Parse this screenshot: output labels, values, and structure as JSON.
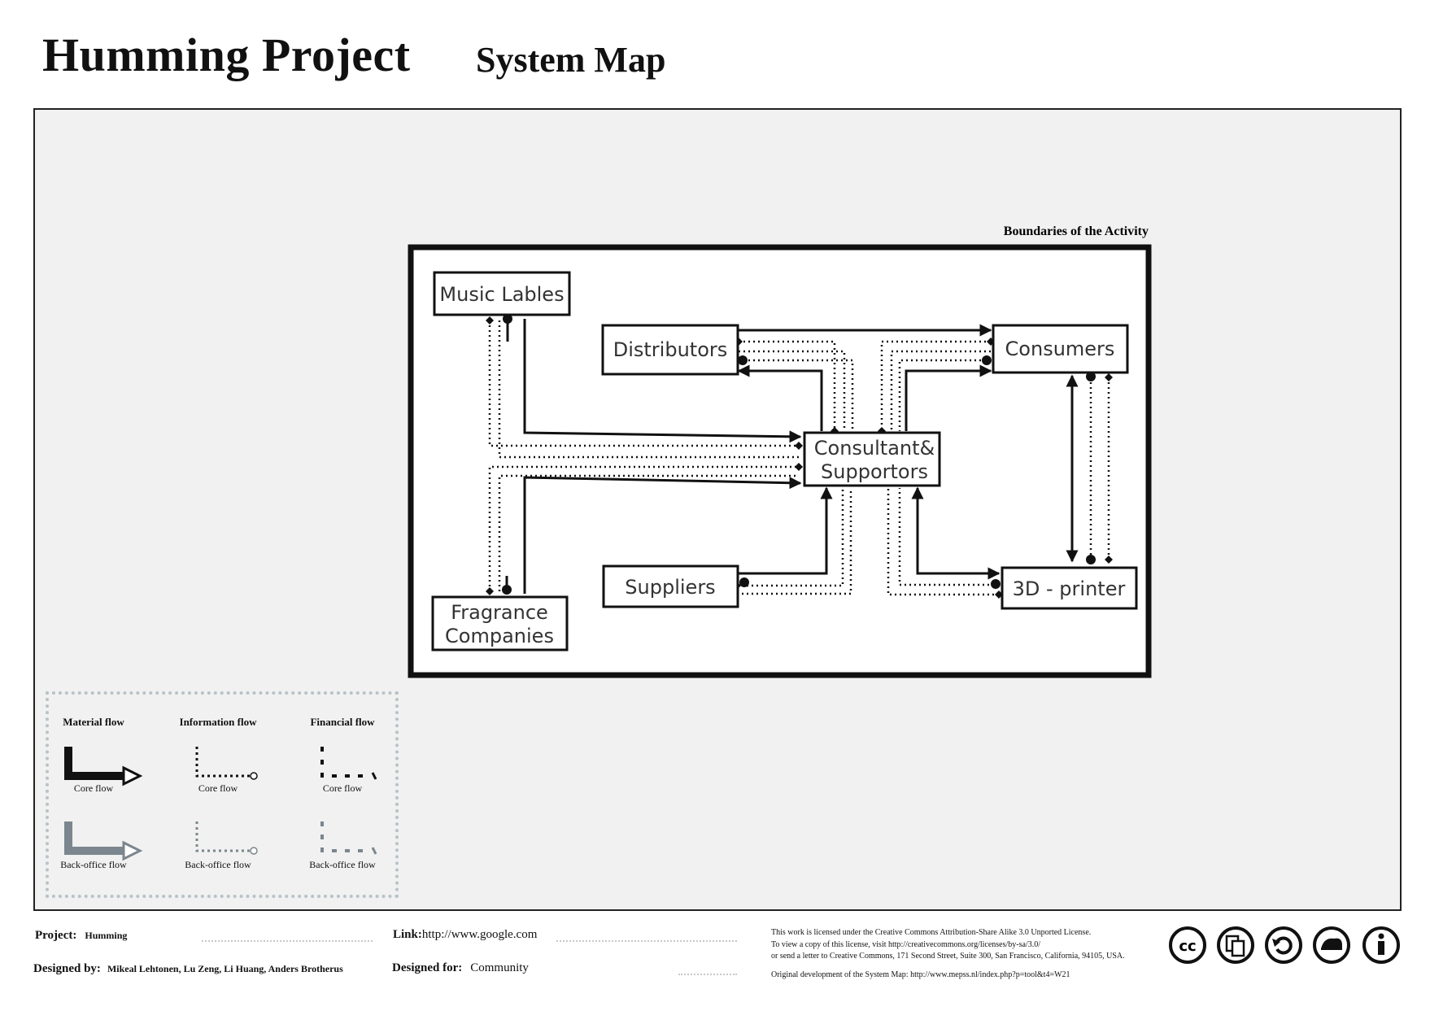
{
  "header": {
    "title": "Humming Project",
    "subtitle": "System Map"
  },
  "boundary_label": "Boundaries of the Activity",
  "nodes": {
    "music": "Music Lables",
    "distributors": "Distributors",
    "consumers": "Consumers",
    "consultant_line1": "Consultant&",
    "consultant_line2": "Supportors",
    "suppliers": "Suppliers",
    "printer": "3D - printer",
    "fragrance_line1": "Fragrance",
    "fragrance_line2": "Companies"
  },
  "legend": {
    "material": "Material flow",
    "information": "Information flow",
    "financial": "Financial flow",
    "core": "Core flow",
    "backoffice": "Back-office flow"
  },
  "footer": {
    "project_label": "Project:",
    "project_value": "Humming",
    "link_label": "Link:",
    "link_value": "http://www.google.com",
    "designed_by_label": "Designed by:",
    "designed_by_value": "Mikeal Lehtonen, Lu Zeng, Li Huang, Anders Brotherus",
    "designed_for_label": "Designed for:",
    "designed_for_value": "Community",
    "license_1": "This work is licensed under the Creative Commons Attribution-Share Alike 3.0 Unported License.",
    "license_2": "To view a copy of this license, visit http://creativecommons.org/licenses/by-sa/3.0/",
    "license_3": "or send a letter to Creative Commons, 171 Second Street, Suite 300, San Francisco, California, 94105, USA.",
    "license_4": "Original development of the System Map: http://www.mepss.nl/index.php?p=tool&t4=W21"
  },
  "cc_icons": [
    "cc-icon",
    "attribution-copy-icon",
    "share-alike-icon",
    "remix-icon",
    "info-icon"
  ]
}
